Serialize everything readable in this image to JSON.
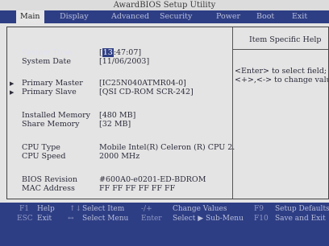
{
  "app": {
    "title": "AwardBIOS Setup Utility"
  },
  "menu": {
    "tabs": [
      {
        "label": "Main"
      },
      {
        "label": "Display"
      },
      {
        "label": "Advanced"
      },
      {
        "label": "Security"
      },
      {
        "label": "Power"
      },
      {
        "label": "Boot"
      },
      {
        "label": "Exit"
      }
    ]
  },
  "main": {
    "system_time": {
      "label": "System Time",
      "hour": "13",
      "rest": ":47:07]",
      "open": "["
    },
    "system_date": {
      "label": "System Date",
      "value": "[11/06/2003]"
    },
    "primary_master": {
      "label": "Primary Master",
      "value": "[IC25N040ATMR04-0]"
    },
    "primary_slave": {
      "label": "Primary Slave",
      "value": "[QSI CD-ROM SCR-242]"
    },
    "installed_memory": {
      "label": "Installed Memory",
      "value": "[480 MB]"
    },
    "share_memory": {
      "label": "Share Memory",
      "value": "[32 MB]"
    },
    "cpu_type": {
      "label": "CPU Type",
      "value": "Mobile Intel(R) Celeron (R) CPU 2."
    },
    "cpu_speed": {
      "label": "CPU Speed",
      "value": "2000 MHz"
    },
    "bios_revision": {
      "label": "BIOS Revision",
      "value": "#600A0-e0201-ED-BDROM"
    },
    "mac_address": {
      "label": "MAC Address",
      "value": "FF FF FF FF FF FF"
    }
  },
  "help": {
    "title": "Item Specific Help",
    "line1": "<Enter> to select field;",
    "line2": "<+>,<-> to change value."
  },
  "footer": {
    "f1_key": "F1",
    "f1_desc": "Help",
    "updown_key": "↑↓",
    "updown_desc": "Select Item",
    "plusminus_key": "-/+",
    "plusminus_desc": "Change Values",
    "f9_key": "F9",
    "f9_desc": "Setup Defaults",
    "esc_key": "ESC",
    "esc_desc": "Exit",
    "leftright_key": "↔",
    "leftright_desc": "Select Menu",
    "enter_key": "Enter",
    "enter_desc": "Select ▶ Sub-Menu",
    "f10_key": "F10",
    "f10_desc": "Save and Exit"
  }
}
